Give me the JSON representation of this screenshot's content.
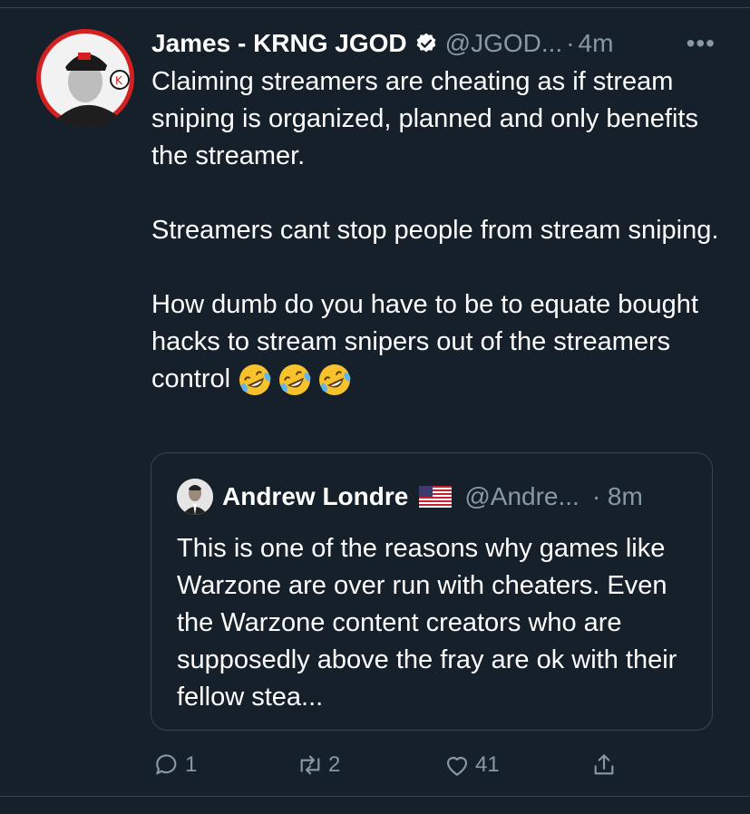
{
  "tweet": {
    "author_name": "James - KRNG JGOD",
    "handle": "@JGOD...",
    "separator": "·",
    "time": "4m",
    "more_label": "•••",
    "paragraphs": [
      "Claiming streamers are cheating as if stream sniping is organized, planned and only benefits the streamer.",
      "Streamers cant stop people from stream sniping.",
      "How dumb do you have to be to equate bought hacks to stream snipers out of the streamers control"
    ],
    "emojis": [
      "rolling-on-floor-laughing",
      "rolling-on-floor-laughing",
      "rolling-on-floor-laughing"
    ]
  },
  "quote": {
    "author_name": "Andrew Londre",
    "flag": "us-flag",
    "handle": "@Andre...",
    "time": "· 8m",
    "text": "This is one of the reasons why games like Warzone are over run with cheaters. Even the Warzone content creators who are supposedly above the fray are ok with their fellow stea..."
  },
  "actions": {
    "reply_count": "1",
    "retweet_count": "2",
    "like_count": "41"
  },
  "colors": {
    "background": "#15202b",
    "secondary_text": "#8899a6",
    "border": "#38444d",
    "verified_badge": "#ffffff"
  }
}
